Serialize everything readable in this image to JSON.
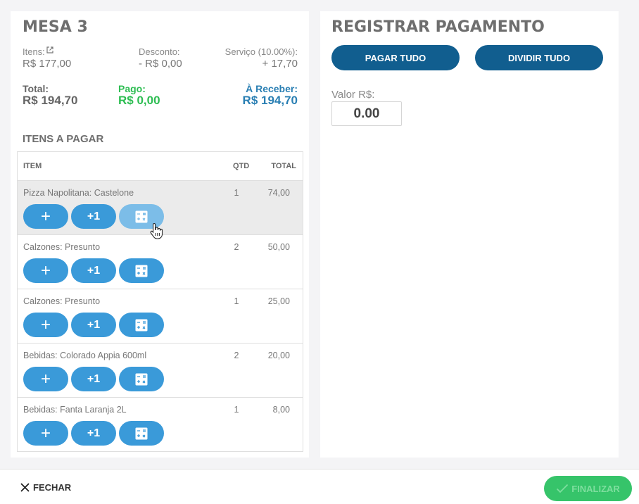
{
  "mesa": {
    "title": "MESA 3",
    "itens_label": "Itens:",
    "itens_value": "R$ 177,00",
    "desconto_label": "Desconto:",
    "desconto_value": "- R$ 0,00",
    "servico_label": "Serviço (10.00%):",
    "servico_value": "+ 17,70",
    "total_label": "Total:",
    "total_value": "R$ 194,70",
    "pago_label": "Pago:",
    "pago_value": "R$ 0,00",
    "receber_label": "À Receber:",
    "receber_value": "R$ 194,70"
  },
  "itens": {
    "title": "ITENS A PAGAR",
    "columns": {
      "item": "ITEM",
      "qtd": "QTD",
      "total": "TOTAL"
    },
    "button_plus": "+",
    "button_plus_one": "+1",
    "calculator_icon": "calculator-icon",
    "rows": [
      {
        "name": "Pizza Napolitana: Castelone",
        "qtd": "1",
        "total": "74,00"
      },
      {
        "name": "Calzones: Presunto",
        "qtd": "2",
        "total": "50,00"
      },
      {
        "name": "Calzones: Presunto",
        "qtd": "1",
        "total": "25,00"
      },
      {
        "name": "Bebidas: Colorado Appia 600ml",
        "qtd": "2",
        "total": "20,00"
      },
      {
        "name": "Bebidas: Fanta Laranja 2L",
        "qtd": "1",
        "total": "8,00"
      }
    ]
  },
  "pagamento": {
    "title": "REGISTRAR PAGAMENTO",
    "pagar_tudo": "PAGAR TUDO",
    "dividir_tudo": "DIVIDIR TUDO",
    "valor_label": "Valor R$:",
    "valor_value": "0.00"
  },
  "footer": {
    "fechar": "FECHAR",
    "finalizar": "FINALIZAR"
  },
  "colors": {
    "primary_dark": "#115e8f",
    "primary": "#3a9ad9",
    "pago_green": "#2dbd52",
    "receber_blue": "#2a7fb3",
    "finalizar_green": "#36c46a"
  }
}
